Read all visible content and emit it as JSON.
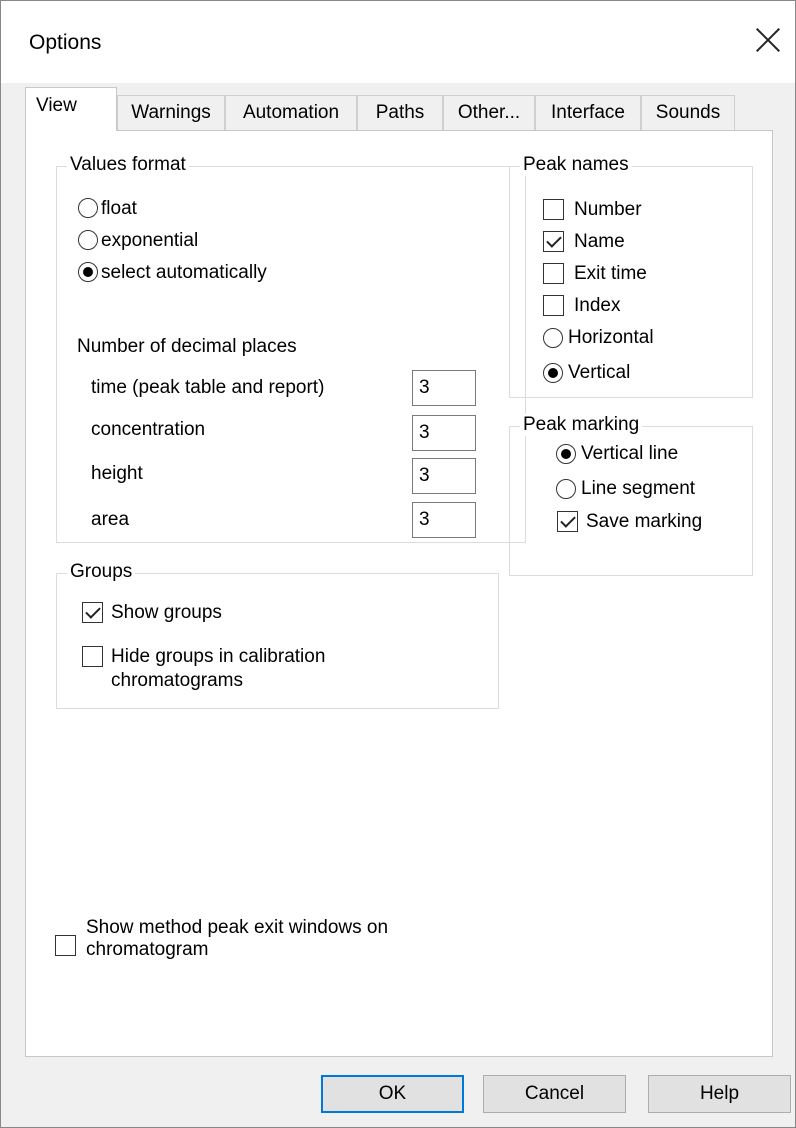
{
  "window": {
    "title": "Options"
  },
  "tabs": [
    "View",
    "Warnings",
    "Automation",
    "Paths",
    "Other...",
    "Interface",
    "Sounds"
  ],
  "values_format": {
    "title": "Values format",
    "options": [
      "float",
      "exponential",
      "select automatically"
    ],
    "selected": "select automatically",
    "decimal_title": "Number of decimal places",
    "decimals": [
      {
        "label": "time (peak table and report)",
        "value": "3"
      },
      {
        "label": "concentration",
        "value": "3"
      },
      {
        "label": "height",
        "value": "3"
      },
      {
        "label": "area",
        "value": "3"
      }
    ]
  },
  "peak_names": {
    "title": "Peak names",
    "checks": [
      {
        "label": "Number",
        "checked": false
      },
      {
        "label": "Name",
        "checked": true
      },
      {
        "label": "Exit time",
        "checked": false
      },
      {
        "label": "Index",
        "checked": false
      }
    ],
    "orientation": [
      "Horizontal",
      "Vertical"
    ],
    "orientation_selected": "Vertical"
  },
  "peak_marking": {
    "title": "Peak marking",
    "options": [
      "Vertical line",
      "Line segment"
    ],
    "selected": "Vertical line",
    "save_label": "Save marking",
    "save_checked": true
  },
  "groups": {
    "title": "Groups",
    "show_label": "Show groups",
    "show_checked": true,
    "hide_label_line1": "Hide groups in calibration",
    "hide_label_line2": "chromatograms",
    "hide_checked": false
  },
  "exit_windows": {
    "label_line1": "Show method peak exit windows on",
    "label_line2": "chromatogram",
    "checked": false
  },
  "buttons": {
    "ok": "OK",
    "cancel": "Cancel",
    "help": "Help"
  }
}
